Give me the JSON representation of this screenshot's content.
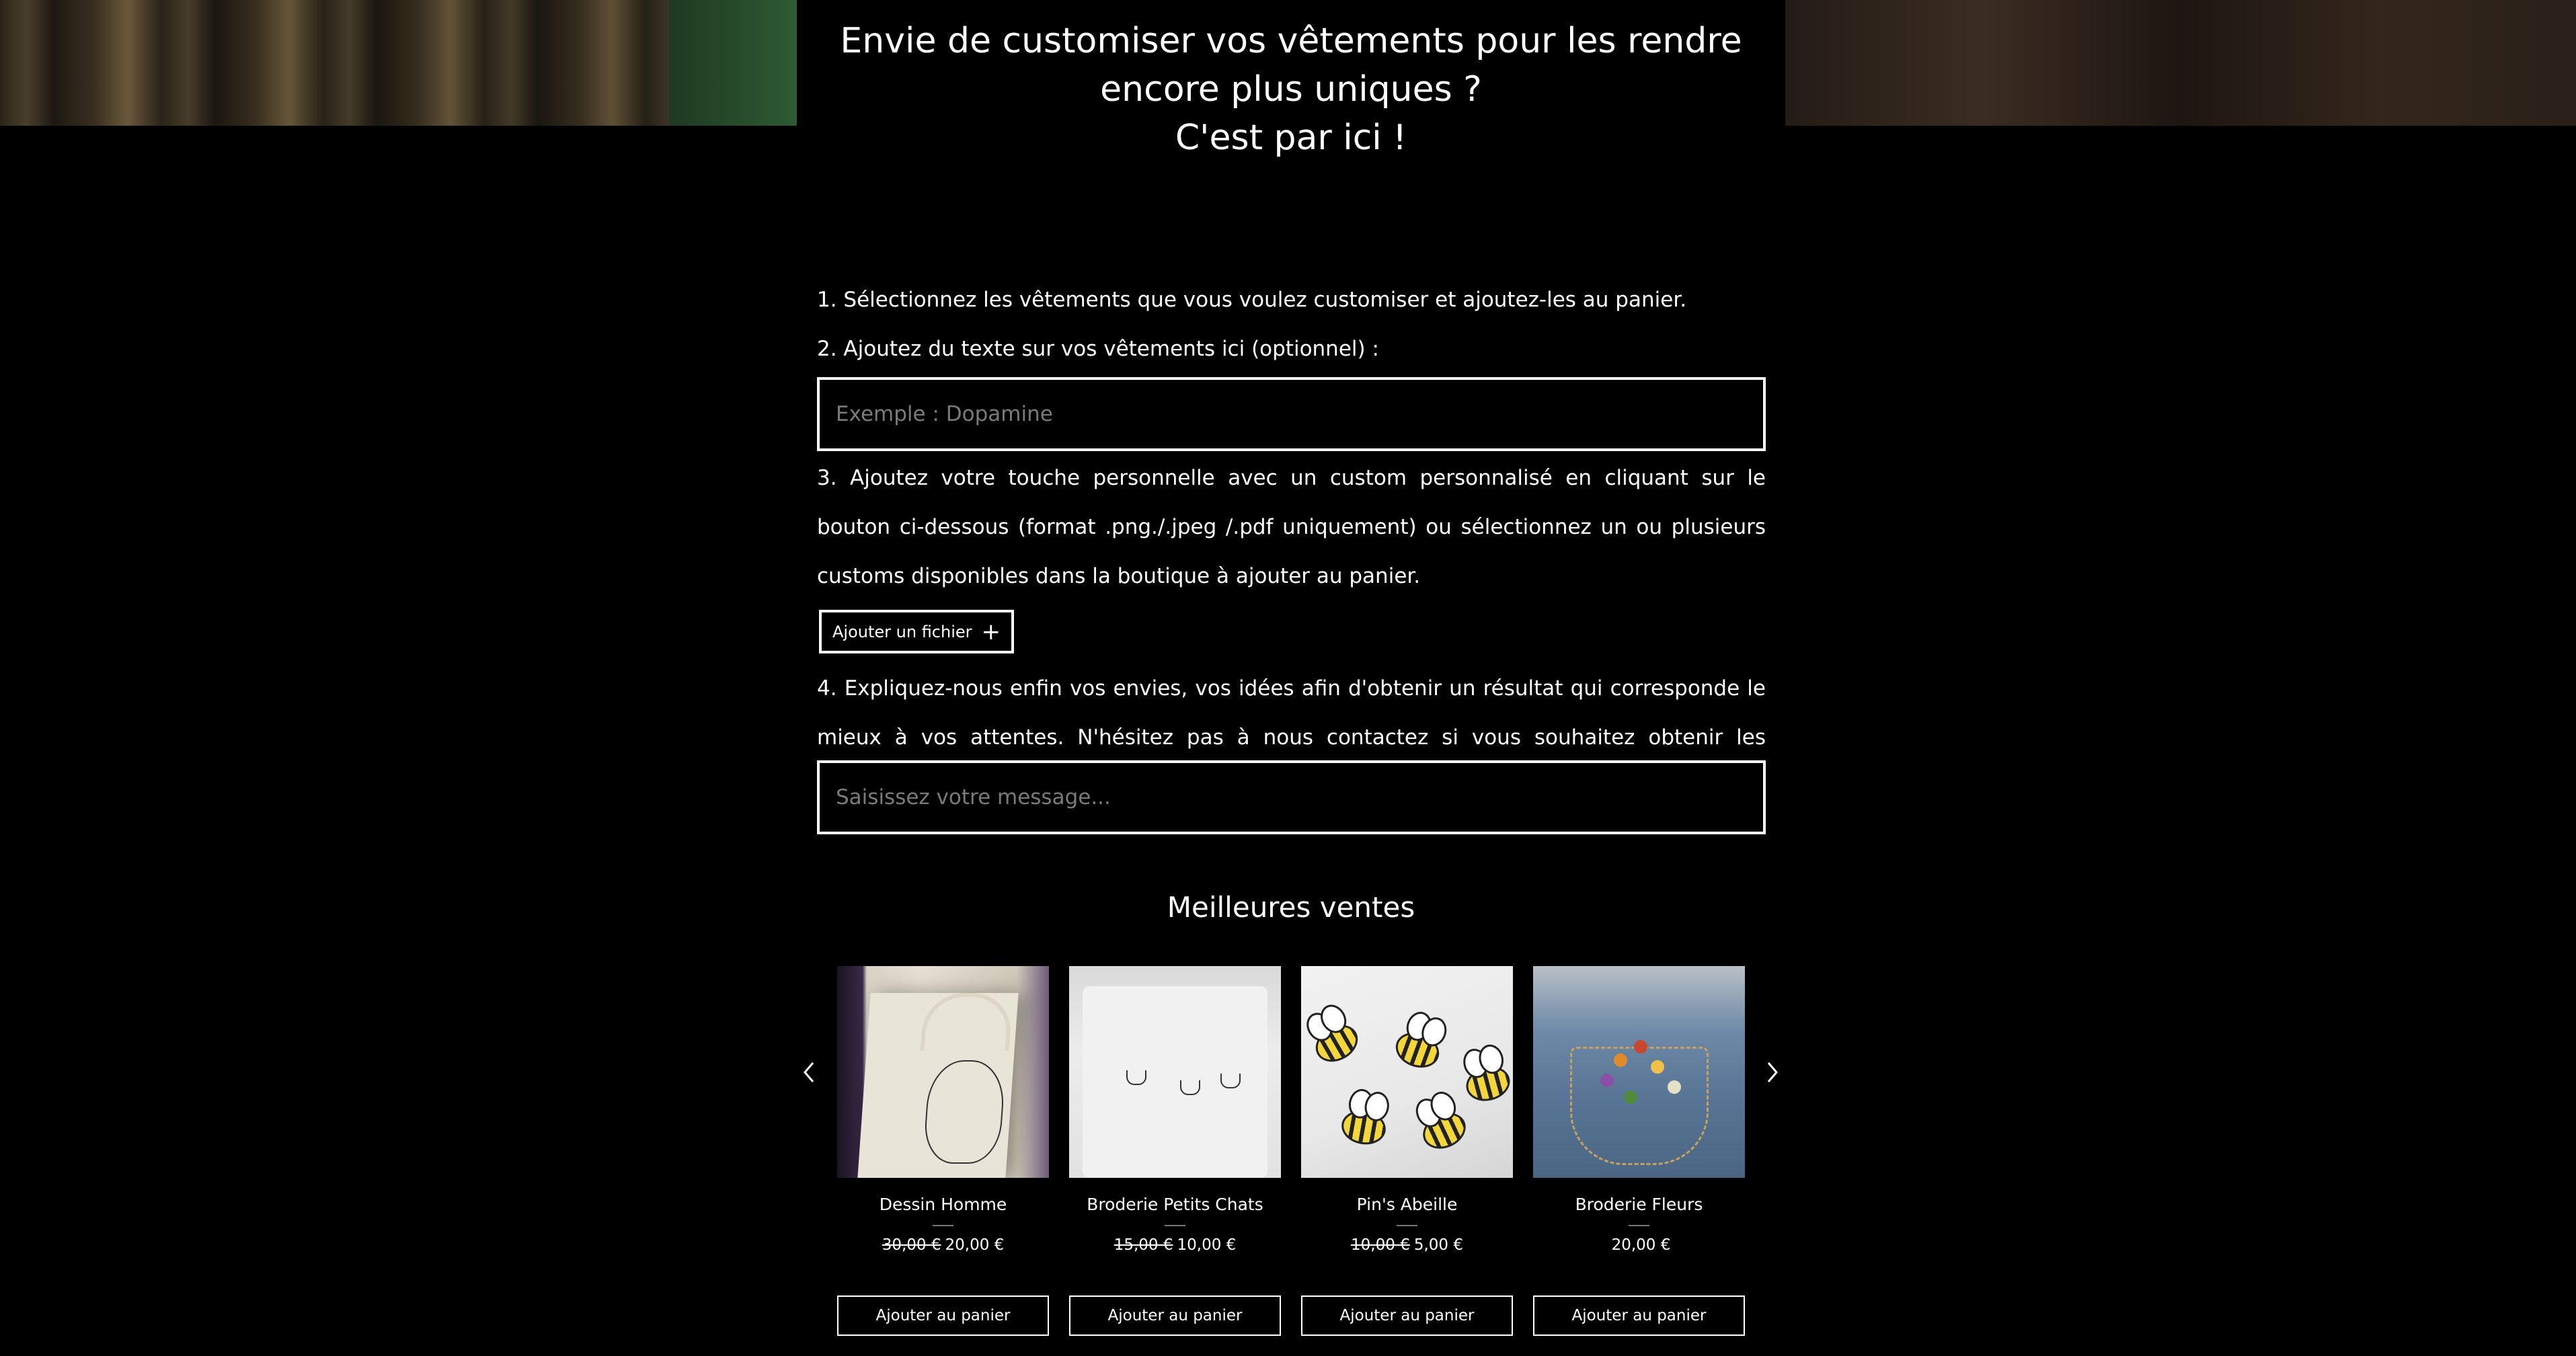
{
  "hero": {
    "line1": "Envie de customiser vos vêtements pour les rendre",
    "line2": "encore plus uniques ?",
    "line3": "C'est par ici !"
  },
  "form": {
    "step1": "1. Sélectionnez les vêtements que vous voulez customiser et ajoutez-les au panier.",
    "step2": "2. Ajoutez du texte sur vos vêtements ici (optionnel) :",
    "text_placeholder": "Exemple : Dopamine",
    "step3": "3. Ajoutez votre touche personnelle avec un custom personnalisé en cliquant sur le bouton ci-dessous (format .png./.jpeg /.pdf uniquement) ou sélectionnez un ou plusieurs customs disponibles dans la boutique à ajouter au panier.",
    "file_button_label": "Ajouter un fichier",
    "step4": "4. Expliquez-nous enfin vos envies, vos idées afin d'obtenir un résultat qui corresponde le mieux à vos attentes. N'hésitez pas à nous contactez si vous souhaitez obtenir les conseils de nos artistes.",
    "message_placeholder": "Saisissez votre message..."
  },
  "best_sellers": {
    "title": "Meilleures ventes",
    "add_to_cart_label": "Ajouter au panier",
    "products": [
      {
        "name": "Dessin Homme",
        "old_price": "30,00 €",
        "price": "20,00 €"
      },
      {
        "name": "Broderie Petits Chats",
        "old_price": "15,00 €",
        "price": "10,00 €"
      },
      {
        "name": "Pin's Abeille",
        "old_price": "10,00 €",
        "price": "5,00 €"
      },
      {
        "name": "Broderie Fleurs",
        "old_price": "",
        "price": "20,00 €"
      }
    ]
  },
  "icons": {
    "prev": "chevron-left-icon",
    "next": "chevron-right-icon",
    "plus": "plus-icon"
  }
}
